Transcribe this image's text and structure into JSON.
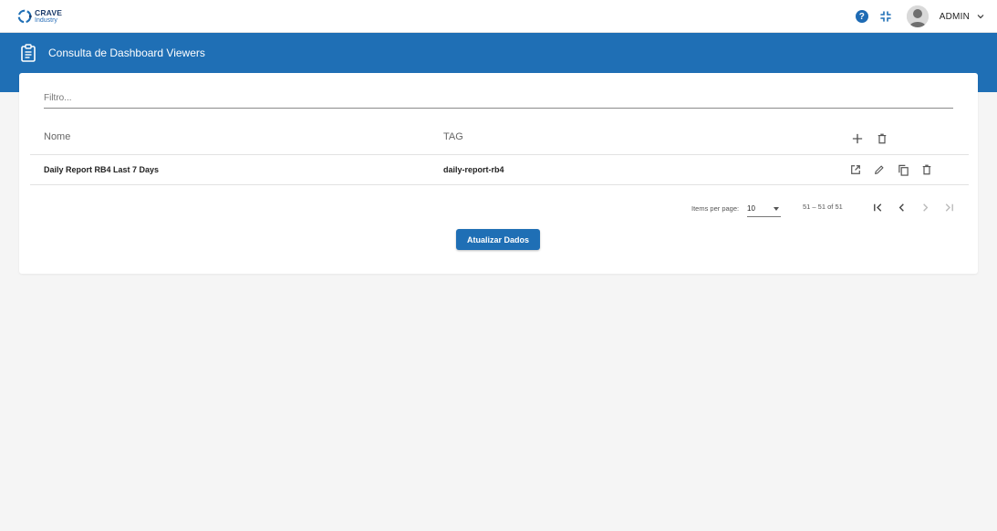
{
  "brand": {
    "name": "CRAVE",
    "subtitle": "Industry",
    "color": "#1f6fb5"
  },
  "topbar": {
    "help_icon": "help-circle-icon",
    "collapse_icon": "collapse-arrows-icon",
    "user_name": "ADMIN",
    "user_menu_icon": "chevron-down-icon"
  },
  "page": {
    "title": "Consulta de Dashboard Viewers",
    "title_icon": "clipboard-icon"
  },
  "filter": {
    "placeholder": "Filtro...",
    "value": ""
  },
  "table": {
    "columns": [
      "Nome",
      "TAG"
    ],
    "header_actions": [
      "add-icon",
      "delete-icon"
    ],
    "rows": [
      {
        "nome": "Daily Report RB4 Last 7 Days",
        "tag": "daily-report-rb4",
        "actions": [
          "open-in-new-icon",
          "edit-icon",
          "copy-icon",
          "delete-icon"
        ]
      }
    ]
  },
  "paginator": {
    "items_per_page_label": "Items per page:",
    "items_per_page": "10",
    "range_label": "51 – 51 of 51"
  },
  "actions": {
    "refresh_label": "Atualizar Dados"
  }
}
